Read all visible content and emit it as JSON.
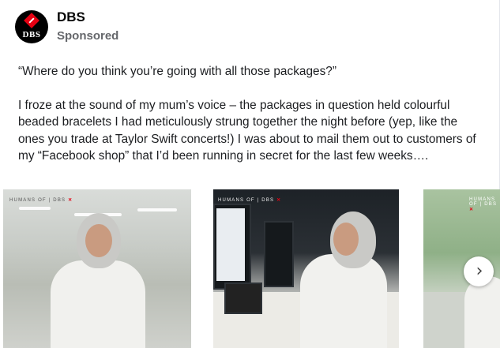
{
  "post": {
    "page_name": "DBS",
    "avatar_text": "DBS",
    "label": "Sponsored",
    "paragraphs": [
      "“Where do you think you’re going with all those packages?”",
      "I froze at the sound of my mum’s voice – the packages in question held colourful beaded bracelets I had meticulously strung together the night before (yep, like the ones you trade at Taylor Swift concerts!) I was about to mail them out to customers of my “Facebook shop” that I’d been running in secret for the last few weeks…."
    ]
  },
  "carousel": {
    "watermark_text": "HUMANS OF | DBS",
    "watermark_mark": "✕",
    "next_icon": "chevron-right-icon",
    "next_glyph": "›"
  },
  "colors": {
    "brand_red": "#e60012",
    "text": "#1c1e21",
    "secondary": "#65676b"
  }
}
